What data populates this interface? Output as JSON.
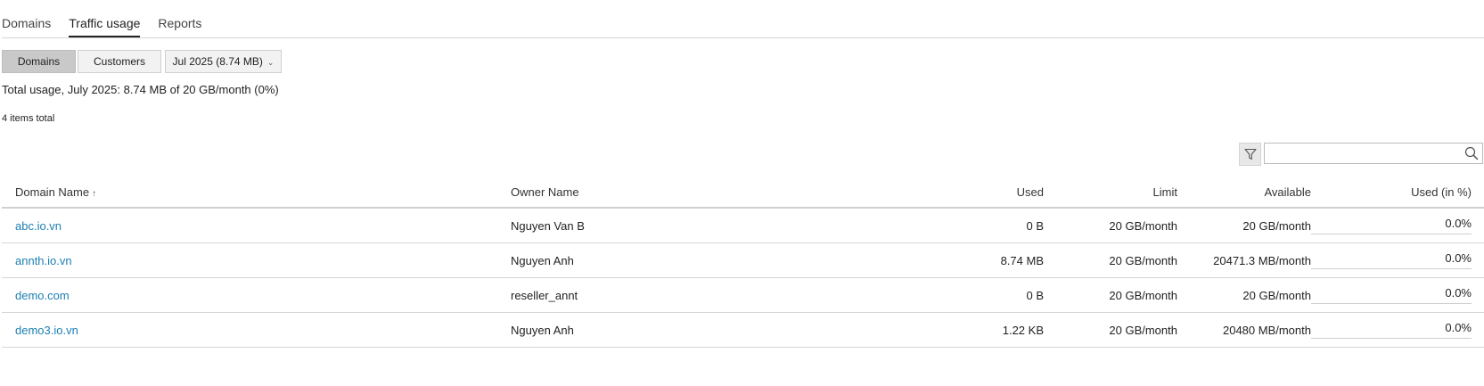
{
  "tabs": [
    {
      "label": "Domains",
      "active": false
    },
    {
      "label": "Traffic usage",
      "active": true
    },
    {
      "label": "Reports",
      "active": false
    }
  ],
  "toolbar": {
    "domains_label": "Domains",
    "customers_label": "Customers",
    "month_label": "Jul 2025 (8.74 MB)",
    "active_segment": "Domains"
  },
  "summary": {
    "total_usage": "Total usage, July 2025: 8.74 MB of 20 GB/month (0%)",
    "items_total": "4 items total"
  },
  "search": {
    "placeholder": "",
    "value": ""
  },
  "table": {
    "headers": {
      "domain": "Domain Name",
      "owner": "Owner Name",
      "used": "Used",
      "limit": "Limit",
      "available": "Available",
      "used_pct": "Used (in %)"
    },
    "sort_indicator": "↑",
    "rows": [
      {
        "domain": "abc.io.vn",
        "owner": "Nguyen Van B",
        "used": "0 B",
        "limit": "20 GB/month",
        "available": "20 GB/month",
        "used_pct": "0.0%"
      },
      {
        "domain": "annth.io.vn",
        "owner": "Nguyen Anh",
        "used": "8.74 MB",
        "limit": "20 GB/month",
        "available": "20471.3 MB/month",
        "used_pct": "0.0%"
      },
      {
        "domain": "demo.com",
        "owner": "reseller_annt",
        "used": "0 B",
        "limit": "20 GB/month",
        "available": "20 GB/month",
        "used_pct": "0.0%"
      },
      {
        "domain": "demo3.io.vn",
        "owner": "Nguyen Anh",
        "used": "1.22 KB",
        "limit": "20 GB/month",
        "available": "20480 MB/month",
        "used_pct": "0.0%"
      }
    ]
  },
  "colors": {
    "link": "#1d7fb3",
    "active_segment_bg": "#c9c9c9"
  },
  "icons": {
    "filter": "filter-icon",
    "search": "search-icon",
    "dropdown": "chevron-down-icon"
  }
}
